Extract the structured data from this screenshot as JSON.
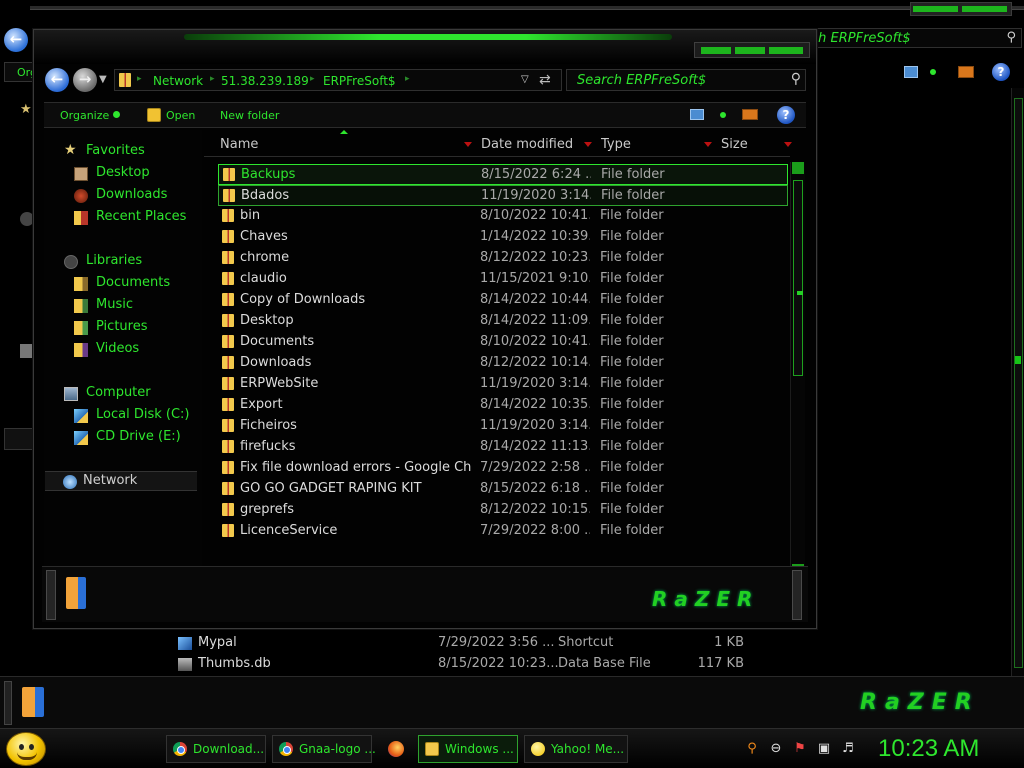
{
  "background_window": {
    "search_text": "ch ERPFreSoft$",
    "cmdbar_label": "Org",
    "logo_text": "RaZER",
    "rows": [
      {
        "name": "Mypal",
        "date": "7/29/2022 3:56 ...",
        "type": "Shortcut",
        "size": "1 KB",
        "icon": "shortcut-icon"
      },
      {
        "name": "Thumbs.db",
        "date": "8/15/2022 10:23...",
        "type": "Data Base File",
        "size": "117 KB",
        "icon": "db-file-icon"
      }
    ]
  },
  "window": {
    "address": {
      "crumbs": [
        "Network",
        "51.38.239.189",
        "ERPFreSoft$"
      ]
    },
    "search_placeholder": "Search ERPFreSoft$",
    "commands": {
      "organize": "Organize",
      "open": "Open",
      "new_folder": "New folder"
    },
    "nav": {
      "favorites": {
        "title": "Favorites",
        "items": [
          "Desktop",
          "Downloads",
          "Recent Places"
        ]
      },
      "libraries": {
        "title": "Libraries",
        "items": [
          "Documents",
          "Music",
          "Pictures",
          "Videos"
        ]
      },
      "computer": {
        "title": "Computer",
        "items": [
          "Local Disk (C:)",
          "CD Drive (E:)"
        ]
      },
      "network": "Network"
    },
    "columns": [
      "Name",
      "Date modified",
      "Type",
      "Size"
    ],
    "files": [
      {
        "name": "Backups",
        "date": "8/15/2022 6:24 ...",
        "type": "File folder",
        "state": "selected"
      },
      {
        "name": "Bdados",
        "date": "11/19/2020 3:14...",
        "type": "File folder",
        "state": "hover"
      },
      {
        "name": "bin",
        "date": "8/10/2022 10:41...",
        "type": "File folder"
      },
      {
        "name": "Chaves",
        "date": "1/14/2022 10:39...",
        "type": "File folder"
      },
      {
        "name": "chrome",
        "date": "8/12/2022 10:23...",
        "type": "File folder"
      },
      {
        "name": "claudio",
        "date": "11/15/2021 9:10...",
        "type": "File folder"
      },
      {
        "name": "Copy of Downloads",
        "date": "8/14/2022 10:44...",
        "type": "File folder"
      },
      {
        "name": "Desktop",
        "date": "8/14/2022 11:09...",
        "type": "File folder"
      },
      {
        "name": "Documents",
        "date": "8/10/2022 10:41...",
        "type": "File folder"
      },
      {
        "name": "Downloads",
        "date": "8/12/2022 10:14...",
        "type": "File folder"
      },
      {
        "name": "ERPWebSite",
        "date": "11/19/2020 3:14...",
        "type": "File folder"
      },
      {
        "name": "Export",
        "date": "8/14/2022 10:35...",
        "type": "File folder"
      },
      {
        "name": "Ficheiros",
        "date": "11/19/2020 3:14...",
        "type": "File folder"
      },
      {
        "name": "firefucks",
        "date": "8/14/2022 11:13...",
        "type": "File folder"
      },
      {
        "name": "Fix file download errors - Google Chr...",
        "date": "7/29/2022 2:58 ...",
        "type": "File folder"
      },
      {
        "name": "GO GO GADGET RAPING KIT",
        "date": "8/15/2022 6:18 ...",
        "type": "File folder"
      },
      {
        "name": "greprefs",
        "date": "8/12/2022 10:15...",
        "type": "File folder"
      },
      {
        "name": "LicenceService",
        "date": "7/29/2022 8:00 ...",
        "type": "File folder"
      }
    ],
    "logo_text": "RaZER"
  },
  "taskbar": {
    "tasks": [
      {
        "label": "Download...",
        "icon": "chrome-icon"
      },
      {
        "label": "Gnaa-logo ...",
        "icon": "chrome-icon"
      },
      {
        "label": "Windows ...",
        "icon": "folder-icon",
        "active": true
      },
      {
        "label": "Yahoo! Me...",
        "icon": "yahoo-messenger-icon"
      }
    ],
    "clock": "10:23 AM"
  },
  "colors": {
    "accent": "#2ee62e",
    "background": "#000000"
  }
}
